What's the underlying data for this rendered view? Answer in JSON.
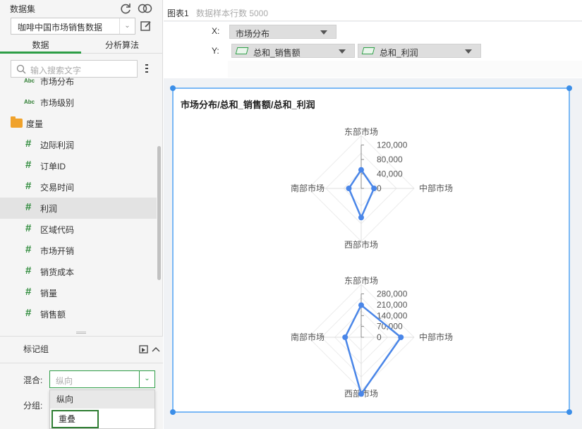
{
  "left": {
    "dataset_label": "数据集",
    "dataset_value": "咖啡中国市场销售数据",
    "tabs": [
      "数据",
      "分析算法"
    ],
    "search_placeholder": "输入搜索文字",
    "dimension_badge": "Abc",
    "fields_dim": [
      "市场分布",
      "市场级别"
    ],
    "measure_folder": "度量",
    "fields_measure": [
      "边际利润",
      "订单ID",
      "交易时间",
      "利润",
      "区域代码",
      "市场开销",
      "销货成本",
      "销量",
      "销售额"
    ],
    "selected_field": "利润",
    "mark_group_title": "标记组",
    "mix_label": "混合:",
    "mix_value": "纵向",
    "group_label": "分组:",
    "dropdown_options": [
      "纵向",
      "重叠"
    ]
  },
  "right": {
    "chart_name": "图表1",
    "sample_count": "数据样本行数 5000",
    "x_label": "X:",
    "x_field": "市场分布",
    "y_label": "Y:",
    "y_fields": [
      "总和_销售额",
      "总和_利润"
    ]
  },
  "chart_data": [
    {
      "type": "radar",
      "title": "市场分布/总和_销售额/总和_利润",
      "categories": [
        "东部市场",
        "中部市场",
        "西部市场",
        "南部市场"
      ],
      "series": [
        {
          "values": [
            84000,
            58000,
            132000,
            56000
          ]
        }
      ],
      "ticks": [
        "0",
        "40,000",
        "80,000",
        "120,000"
      ],
      "rmax": 240000,
      "color": "#4a86e8"
    },
    {
      "type": "radar",
      "categories": [
        "东部市场",
        "中部市场",
        "西部市场",
        "南部市场"
      ],
      "series": [
        {
          "values": [
            170000,
            210000,
            300000,
            85000
          ]
        }
      ],
      "ticks": [
        "0",
        "70,000",
        "140,000",
        "210,000",
        "280,000"
      ],
      "rmax": 280000,
      "color": "#4a86e8"
    }
  ]
}
